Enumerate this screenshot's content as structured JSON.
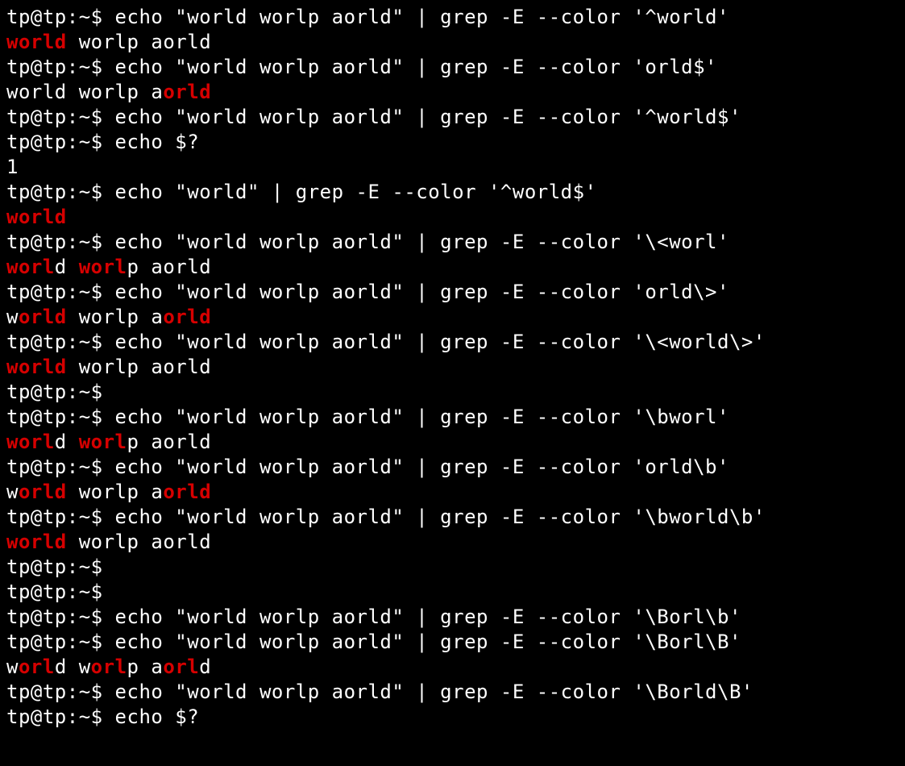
{
  "prompt": "tp@tp:~$ ",
  "colors": {
    "match": "#d60000",
    "fg": "#ffffff",
    "bg": "#000000"
  },
  "lines": [
    {
      "type": "cmd",
      "text": "echo \"world worlp aorld\" | grep -E --color '^world'"
    },
    {
      "type": "out",
      "segments": [
        {
          "t": "world",
          "hl": true
        },
        {
          "t": " worlp aorld",
          "hl": false
        }
      ]
    },
    {
      "type": "cmd",
      "text": "echo \"world worlp aorld\" | grep -E --color 'orld$'"
    },
    {
      "type": "out",
      "segments": [
        {
          "t": "world worlp a",
          "hl": false
        },
        {
          "t": "orld",
          "hl": true
        }
      ]
    },
    {
      "type": "cmd",
      "text": "echo \"world worlp aorld\" | grep -E --color '^world$'"
    },
    {
      "type": "cmd",
      "text": "echo $?"
    },
    {
      "type": "out",
      "segments": [
        {
          "t": "1",
          "hl": false
        }
      ]
    },
    {
      "type": "cmd",
      "text": "echo \"world\" | grep -E --color '^world$'"
    },
    {
      "type": "out",
      "segments": [
        {
          "t": "world",
          "hl": true
        }
      ]
    },
    {
      "type": "cmd",
      "text": "echo \"world worlp aorld\" | grep -E --color '\\<worl'"
    },
    {
      "type": "out",
      "segments": [
        {
          "t": "worl",
          "hl": true
        },
        {
          "t": "d ",
          "hl": false
        },
        {
          "t": "worl",
          "hl": true
        },
        {
          "t": "p aorld",
          "hl": false
        }
      ]
    },
    {
      "type": "cmd",
      "text": "echo \"world worlp aorld\" | grep -E --color 'orld\\>'"
    },
    {
      "type": "out",
      "segments": [
        {
          "t": "w",
          "hl": false
        },
        {
          "t": "orld",
          "hl": true
        },
        {
          "t": " worlp a",
          "hl": false
        },
        {
          "t": "orld",
          "hl": true
        }
      ]
    },
    {
      "type": "cmd",
      "text": "echo \"world worlp aorld\" | grep -E --color '\\<world\\>'"
    },
    {
      "type": "out",
      "segments": [
        {
          "t": "world",
          "hl": true
        },
        {
          "t": " worlp aorld",
          "hl": false
        }
      ]
    },
    {
      "type": "cmd",
      "text": ""
    },
    {
      "type": "cmd",
      "text": "echo \"world worlp aorld\" | grep -E --color '\\bworl'"
    },
    {
      "type": "out",
      "segments": [
        {
          "t": "worl",
          "hl": true
        },
        {
          "t": "d ",
          "hl": false
        },
        {
          "t": "worl",
          "hl": true
        },
        {
          "t": "p aorld",
          "hl": false
        }
      ]
    },
    {
      "type": "cmd",
      "text": "echo \"world worlp aorld\" | grep -E --color 'orld\\b'"
    },
    {
      "type": "out",
      "segments": [
        {
          "t": "w",
          "hl": false
        },
        {
          "t": "orld",
          "hl": true
        },
        {
          "t": " worlp a",
          "hl": false
        },
        {
          "t": "orld",
          "hl": true
        }
      ]
    },
    {
      "type": "cmd",
      "text": "echo \"world worlp aorld\" | grep -E --color '\\bworld\\b'"
    },
    {
      "type": "out",
      "segments": [
        {
          "t": "world",
          "hl": true
        },
        {
          "t": " worlp aorld",
          "hl": false
        }
      ]
    },
    {
      "type": "cmd",
      "text": ""
    },
    {
      "type": "cmd",
      "text": ""
    },
    {
      "type": "cmd",
      "text": "echo \"world worlp aorld\" | grep -E --color '\\Borl\\b'"
    },
    {
      "type": "cmd",
      "text": "echo \"world worlp aorld\" | grep -E --color '\\Borl\\B'"
    },
    {
      "type": "out",
      "segments": [
        {
          "t": "w",
          "hl": false
        },
        {
          "t": "orl",
          "hl": true
        },
        {
          "t": "d w",
          "hl": false
        },
        {
          "t": "orl",
          "hl": true
        },
        {
          "t": "p a",
          "hl": false
        },
        {
          "t": "orl",
          "hl": true
        },
        {
          "t": "d",
          "hl": false
        }
      ]
    },
    {
      "type": "cmd",
      "text": "echo \"world worlp aorld\" | grep -E --color '\\Borld\\B'"
    },
    {
      "type": "cmd",
      "text": "echo $?"
    }
  ]
}
